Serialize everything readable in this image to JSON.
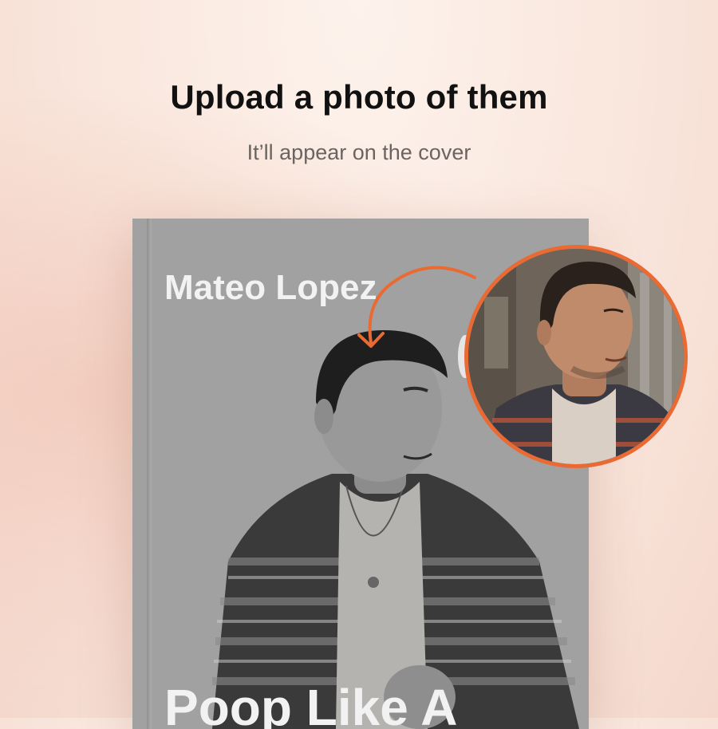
{
  "header": {
    "title": "Upload a photo of them",
    "subtitle": "It’ll appear on the cover"
  },
  "book": {
    "author": "Mateo Lopez",
    "title_fragment": "Poop Like A"
  },
  "icons": {
    "arrow": "curved-arrow-icon",
    "photo": "uploaded-photo"
  },
  "colors": {
    "accent": "#ea6a34",
    "cover_gray": "#a1a1a1",
    "title_text": "#111111",
    "subtitle_text": "#6b6460"
  }
}
